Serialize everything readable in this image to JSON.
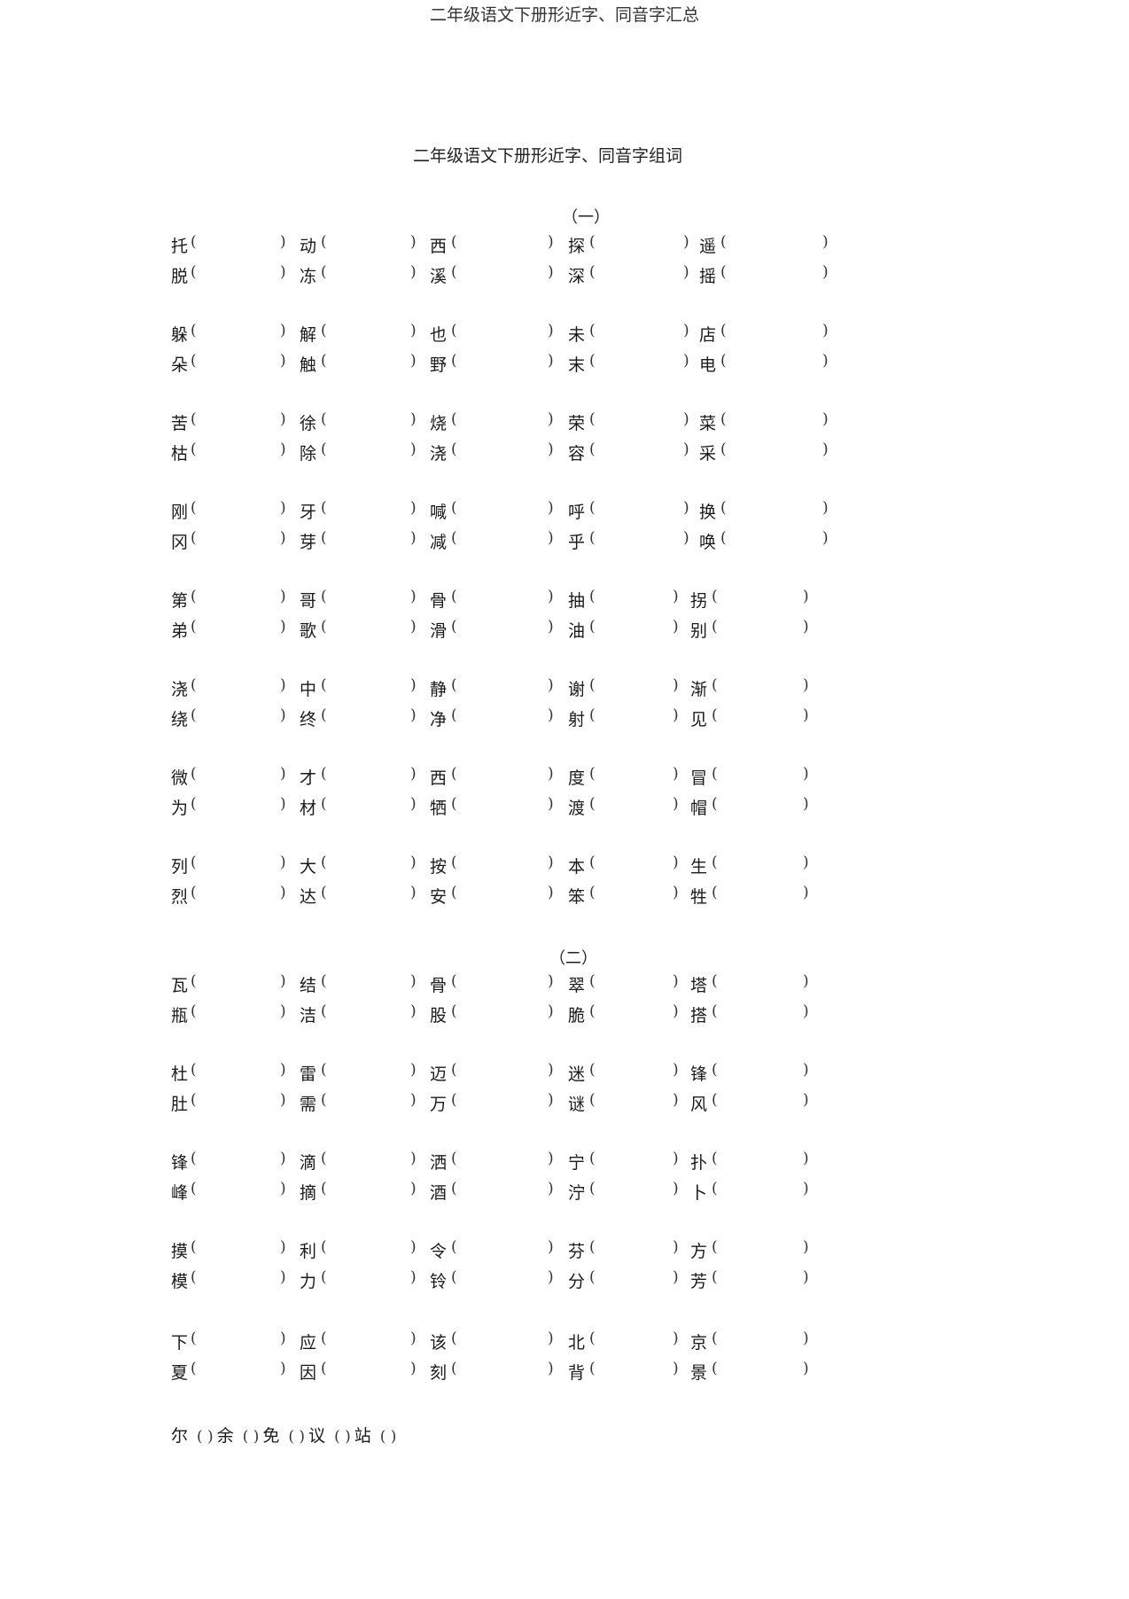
{
  "header": {
    "title": "二年级语文下册形近字、同音字汇总"
  },
  "document": {
    "title": "二年级语文下册形近字、同音字组词",
    "sections": [
      {
        "label": "（一）",
        "groups": [
          {
            "rows": [
              [
                "托",
                "动",
                "西",
                "探",
                "遥"
              ],
              [
                "脱",
                "冻",
                "溪",
                "深",
                "摇"
              ]
            ]
          },
          {
            "rows": [
              [
                "躲",
                "解",
                "也",
                "未",
                "店"
              ],
              [
                "朵",
                "触",
                "野",
                "末",
                "电"
              ]
            ]
          },
          {
            "rows": [
              [
                "苦",
                "徐",
                "烧",
                "荣",
                "菜"
              ],
              [
                "枯",
                "除",
                "浇",
                "容",
                "采"
              ]
            ]
          },
          {
            "rows": [
              [
                "刚",
                "牙",
                "喊",
                "呼",
                "换"
              ],
              [
                "冈",
                "芽",
                "减",
                "乎",
                "唤"
              ]
            ]
          },
          {
            "rows": [
              [
                "第",
                "哥",
                "骨",
                "抽",
                "拐"
              ],
              [
                "弟",
                "歌",
                "滑",
                "油",
                "别"
              ]
            ]
          },
          {
            "rows": [
              [
                "浇",
                "中",
                "静",
                "谢",
                "渐"
              ],
              [
                "绕",
                "终",
                "净",
                "射",
                "见"
              ]
            ]
          },
          {
            "rows": [
              [
                "微",
                "才",
                "西",
                "度",
                "冒"
              ],
              [
                "为",
                "材",
                "牺",
                "渡",
                "帽"
              ]
            ]
          },
          {
            "rows": [
              [
                "列",
                "大",
                "按",
                "本",
                "生"
              ],
              [
                "烈",
                "达",
                "安",
                "笨",
                "牲"
              ]
            ]
          }
        ]
      },
      {
        "label": "（二）",
        "groups": [
          {
            "rows": [
              [
                "瓦",
                "结",
                "骨",
                "翠",
                "塔"
              ],
              [
                "瓶",
                "洁",
                "股",
                "脆",
                "搭"
              ]
            ]
          },
          {
            "rows": [
              [
                "杜",
                "雷",
                "迈",
                "迷",
                "锋"
              ],
              [
                "肚",
                "需",
                "万",
                "谜",
                "风"
              ]
            ]
          },
          {
            "rows": [
              [
                "锋",
                "滴",
                "洒",
                "宁",
                "扑"
              ],
              [
                "峰",
                "摘",
                "酒",
                "泞",
                "卜"
              ]
            ]
          },
          {
            "rows": [
              [
                "摸",
                "利",
                "令",
                "芬",
                "方"
              ],
              [
                "模",
                "力",
                "铃",
                "分",
                "芳"
              ]
            ]
          },
          {
            "rows": [
              [
                "下",
                "应",
                "该",
                "北",
                "京"
              ],
              [
                "夏",
                "因",
                "刻",
                "背",
                "景"
              ]
            ]
          }
        ]
      }
    ],
    "last_line": [
      "尔",
      "余",
      "免",
      "议",
      "站"
    ],
    "paren_open": "（",
    "paren_close": "）"
  }
}
